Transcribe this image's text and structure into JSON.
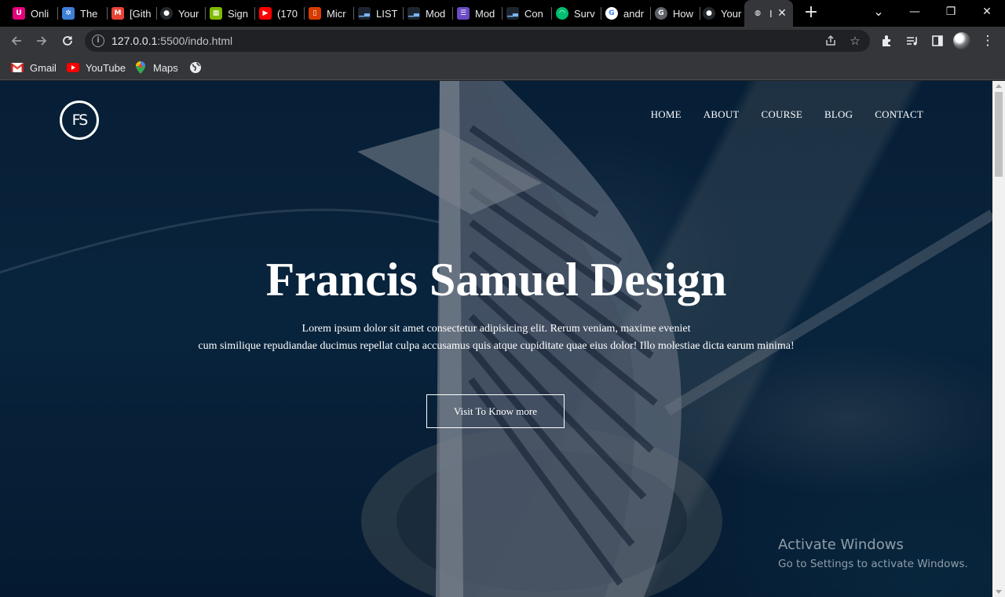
{
  "tabs": [
    {
      "title": "Onli",
      "icon": "u-app-icon",
      "color": "#e6007e",
      "glyph": "U"
    },
    {
      "title": "The",
      "icon": "snowflake-icon",
      "color": "#3d7fd6",
      "glyph": "✲"
    },
    {
      "title": "[Gith",
      "icon": "gmail-icon",
      "color": "#ea4335",
      "glyph": "M"
    },
    {
      "title": "Your",
      "icon": "github-icon",
      "color": "#24292e",
      "glyph": "●"
    },
    {
      "title": "Sign",
      "icon": "microsoft-icon",
      "color": "#7fba00",
      "glyph": "▦"
    },
    {
      "title": "(170",
      "icon": "youtube-icon",
      "color": "#ff0000",
      "glyph": "▶"
    },
    {
      "title": "Micr",
      "icon": "office-icon",
      "color": "#d83b01",
      "glyph": "▯"
    },
    {
      "title": "LIST",
      "icon": "chart-icon",
      "color": "#1f2530",
      "glyph": "▁▃"
    },
    {
      "title": "Mod",
      "icon": "chart-icon",
      "color": "#1f2530",
      "glyph": "▁▃"
    },
    {
      "title": "Mod",
      "icon": "list-icon",
      "color": "#6a4bc4",
      "glyph": "☰"
    },
    {
      "title": "Con",
      "icon": "chart-icon",
      "color": "#1f2530",
      "glyph": "▁▃"
    },
    {
      "title": "Surv",
      "icon": "surveymonkey-icon",
      "color": "#00bf6f",
      "glyph": "◠"
    },
    {
      "title": "andr",
      "icon": "google-icon",
      "color": "#ffffff",
      "glyph": "G"
    },
    {
      "title": "How",
      "icon": "g-circle-icon",
      "color": "#5f6368",
      "glyph": "G"
    },
    {
      "title": "Your",
      "icon": "github-icon",
      "color": "#24292e",
      "glyph": "●"
    },
    {
      "title": "I",
      "icon": "globe-icon",
      "color": "#35363a",
      "glyph": "◍"
    }
  ],
  "window": {
    "minimize": "—",
    "restore": "❐",
    "close": "✕",
    "tab_search": "⌄",
    "new_tab": "+"
  },
  "toolbar": {
    "url_host": "127.0.0.1",
    "url_rest": ":5500/indo.html",
    "info_glyph": "i"
  },
  "bookmarks": [
    {
      "label": "Gmail",
      "icon": "gmail-icon"
    },
    {
      "label": "YouTube",
      "icon": "youtube-icon"
    },
    {
      "label": "Maps",
      "icon": "maps-pin-icon"
    },
    {
      "label": "",
      "icon": "globe-icon"
    }
  ],
  "site": {
    "logo_text": "FS",
    "nav": [
      "HOME",
      "ABOUT",
      "COURSE",
      "BLOG",
      "CONTACT"
    ],
    "title": "Francis Samuel Design",
    "subtitle_line1": "Lorem ipsum dolor sit amet consectetur adipisicing elit. Rerum veniam, maxime eveniet",
    "subtitle_line2": "cum similique repudiandae ducimus repellat culpa accusamus quis atque cupiditate quae eius dolor! Illo molestiae dicta earum minima!",
    "cta": "Visit To Know more"
  },
  "watermark": {
    "line1": "Activate Windows",
    "line2": "Go to Settings to activate Windows."
  }
}
